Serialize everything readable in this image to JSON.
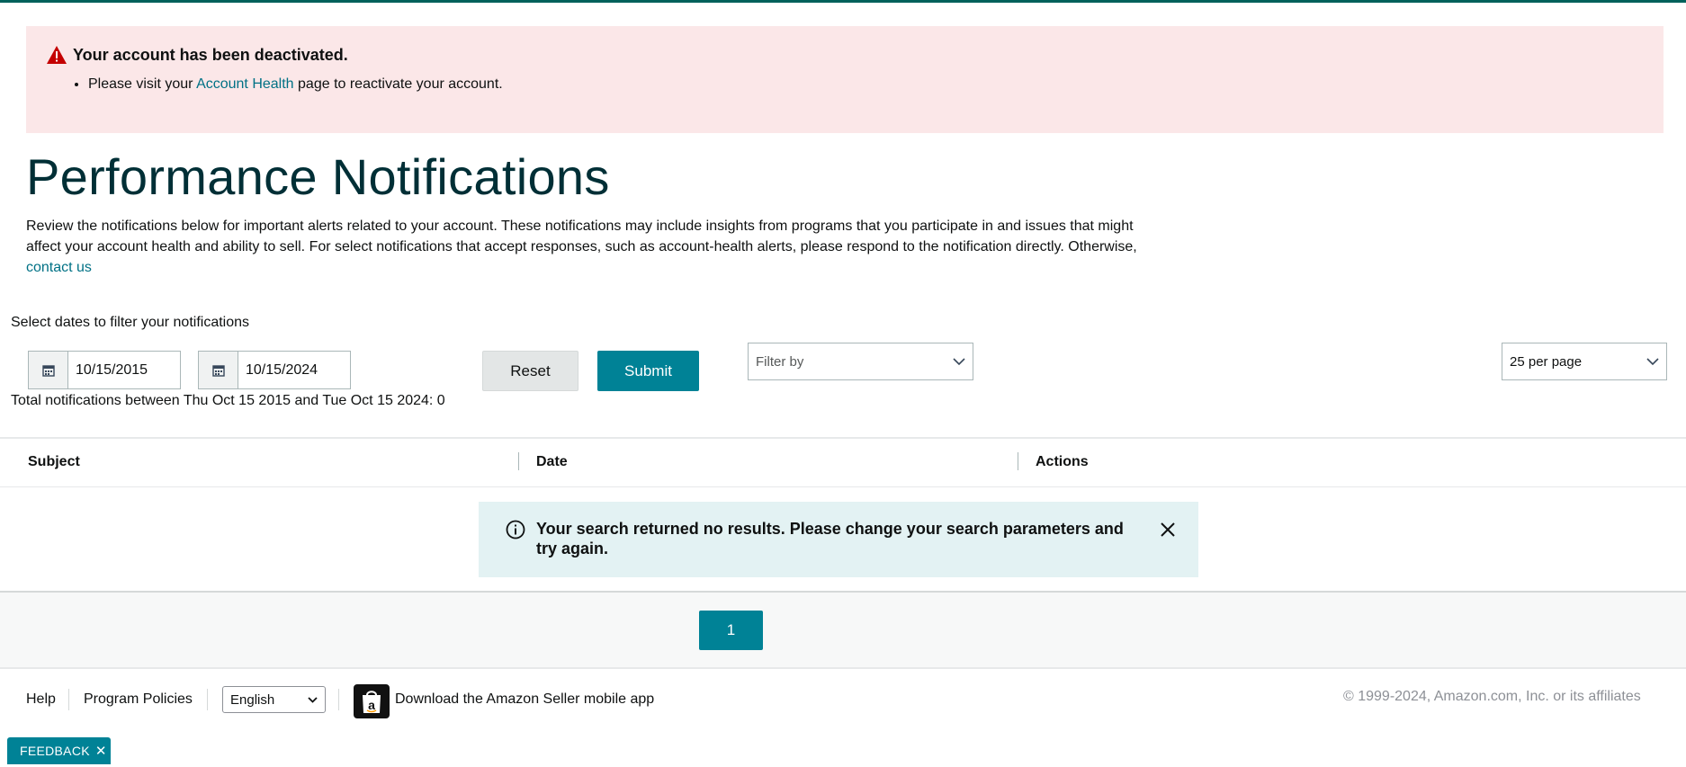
{
  "alert": {
    "title": "Your account has been deactivated.",
    "message_prefix": "Please visit your ",
    "message_link": "Account Health",
    "message_suffix": " page to reactivate your account.",
    "icon": "warning-triangle-icon",
    "color": "#c40000"
  },
  "page": {
    "title": "Performance Notifications",
    "description": "Review the notifications below for important alerts related to your account. These notifications may include insights from programs that you participate in and issues that might affect your account health and ability to sell. For select notifications that accept responses, such as account-health alerts, please respond to the notification directly. Otherwise, ",
    "contact_link": "contact us"
  },
  "filters": {
    "label": "Select dates to filter your notifications",
    "start_date": "10/15/2015",
    "end_date": "10/15/2024",
    "reset_label": "Reset",
    "submit_label": "Submit",
    "filter_by_placeholder": "Filter by",
    "per_page": "25 per page",
    "total_text": "Total notifications between Thu Oct 15 2015 and Tue Oct 15 2024: 0"
  },
  "table": {
    "columns": [
      "Subject",
      "Date",
      "Actions"
    ],
    "rows": [],
    "empty_message": "Your search returned no results. Please change your search parameters and try again."
  },
  "pagination": {
    "current_page": "1"
  },
  "footer": {
    "help": "Help",
    "program_policies": "Program Policies",
    "language": "English",
    "app_download": "Download the Amazon Seller mobile app",
    "copyright": "© 1999-2024, Amazon.com, Inc. or its affiliates"
  },
  "feedback": {
    "label": "FEEDBACK",
    "close": "✕"
  },
  "colors": {
    "accent": "#008296",
    "alert_bg": "#fbe7e8",
    "info_bg": "#e3f2f3",
    "title": "#002f36"
  }
}
